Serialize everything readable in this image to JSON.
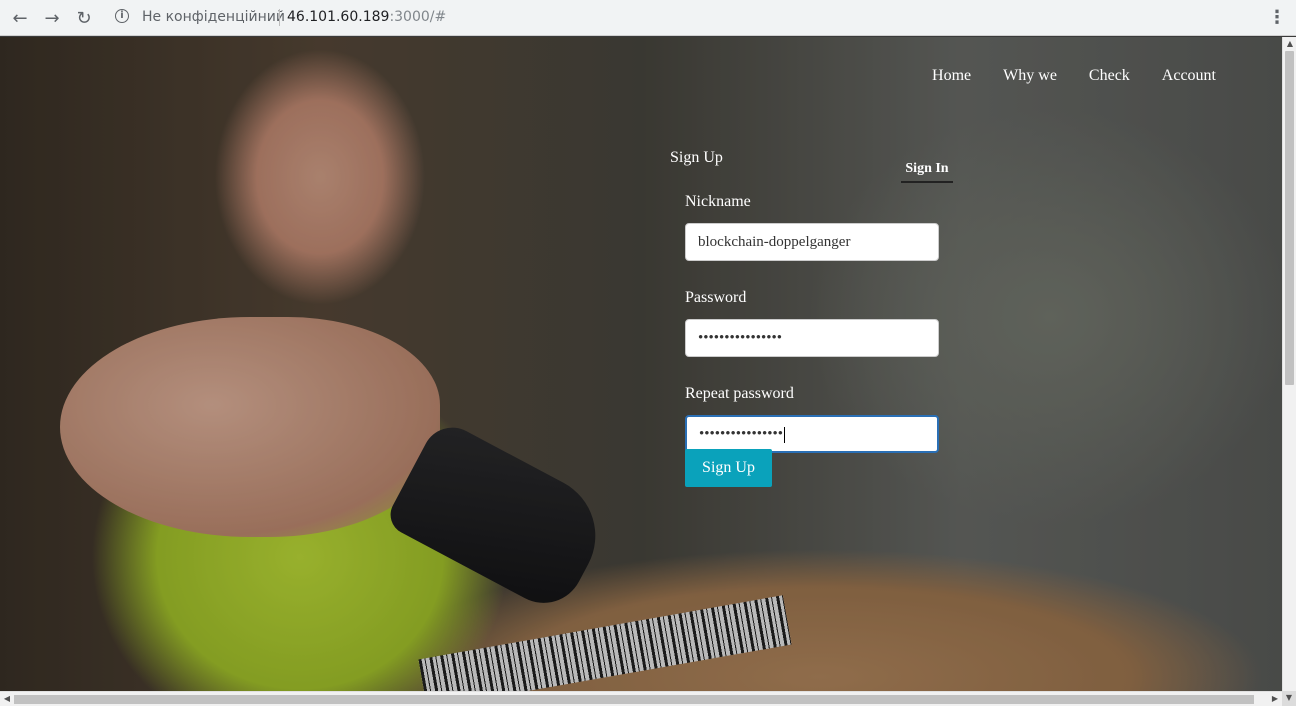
{
  "browser": {
    "back_icon": "arrow-left-icon",
    "forward_icon": "arrow-right-icon",
    "reload_icon": "reload-icon",
    "security_text": "Не конфіденційний",
    "url_host": "46.101.60.189",
    "url_rest": ":3000/#"
  },
  "nav": {
    "items": [
      {
        "label": "Home"
      },
      {
        "label": "Why we"
      },
      {
        "label": "Check"
      },
      {
        "label": "Account"
      }
    ]
  },
  "auth": {
    "tab_signup": "Sign Up",
    "tab_signin": "Sign In",
    "nickname_label": "Nickname",
    "nickname_value": "blockchain-doppelganger",
    "password_label": "Password",
    "password_value": "••••••••••••••••",
    "repeat_label": "Repeat password",
    "repeat_value": "••••••••••••••••",
    "submit_label": "Sign Up"
  },
  "colors": {
    "accent_button": "#0aa2bb",
    "focus_border": "#2a6fb5"
  }
}
